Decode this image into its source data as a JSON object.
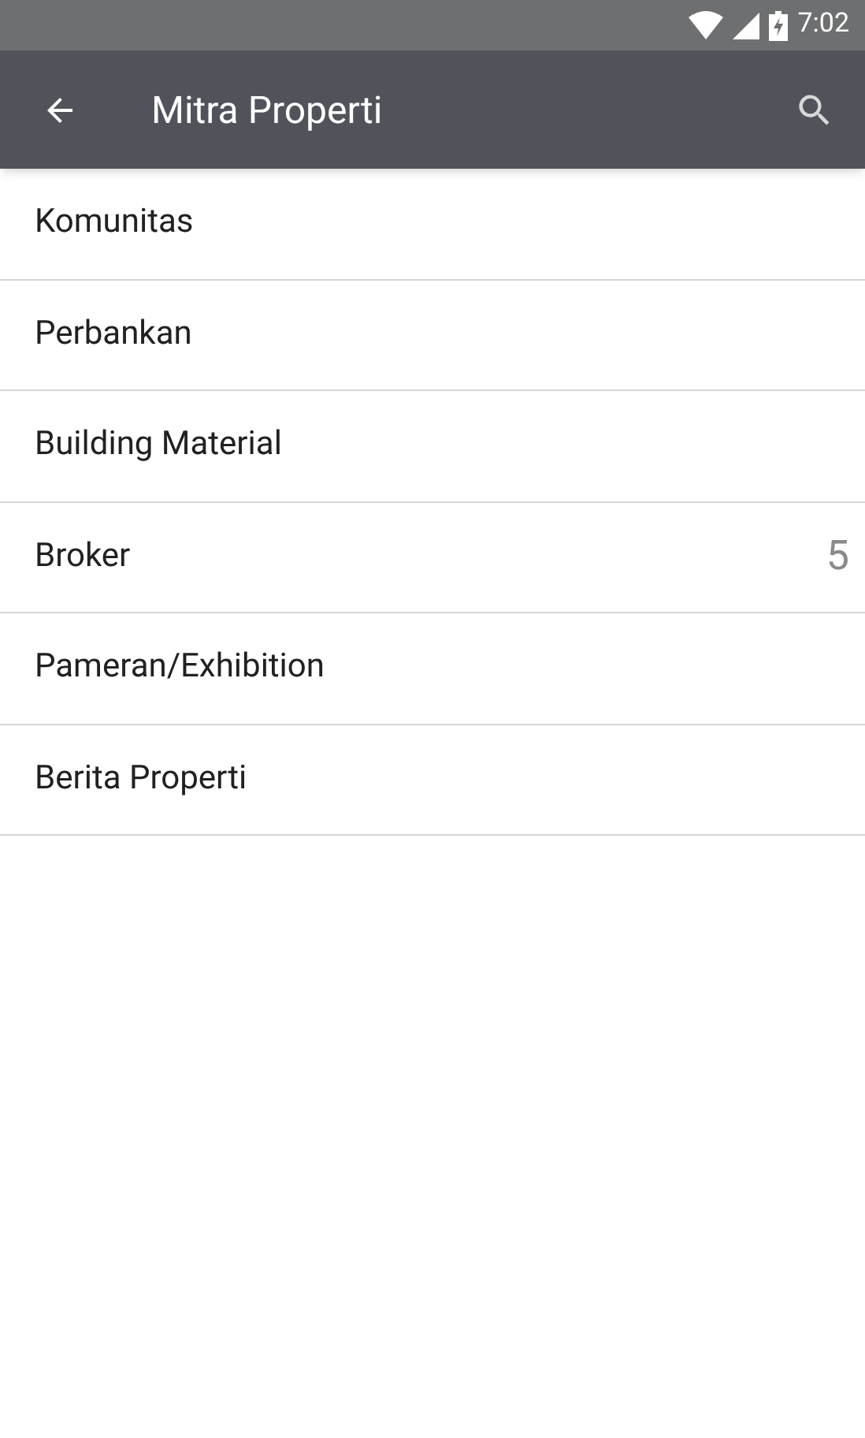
{
  "status_bar": {
    "time": "7:02"
  },
  "app_bar": {
    "title": "Mitra Properti"
  },
  "items": [
    {
      "label": "Komunitas"
    },
    {
      "label": "Perbankan"
    },
    {
      "label": "Building Material"
    },
    {
      "label": "Broker",
      "count": "5"
    },
    {
      "label": "Pameran/Exhibition"
    },
    {
      "label": "Berita Properti"
    }
  ]
}
